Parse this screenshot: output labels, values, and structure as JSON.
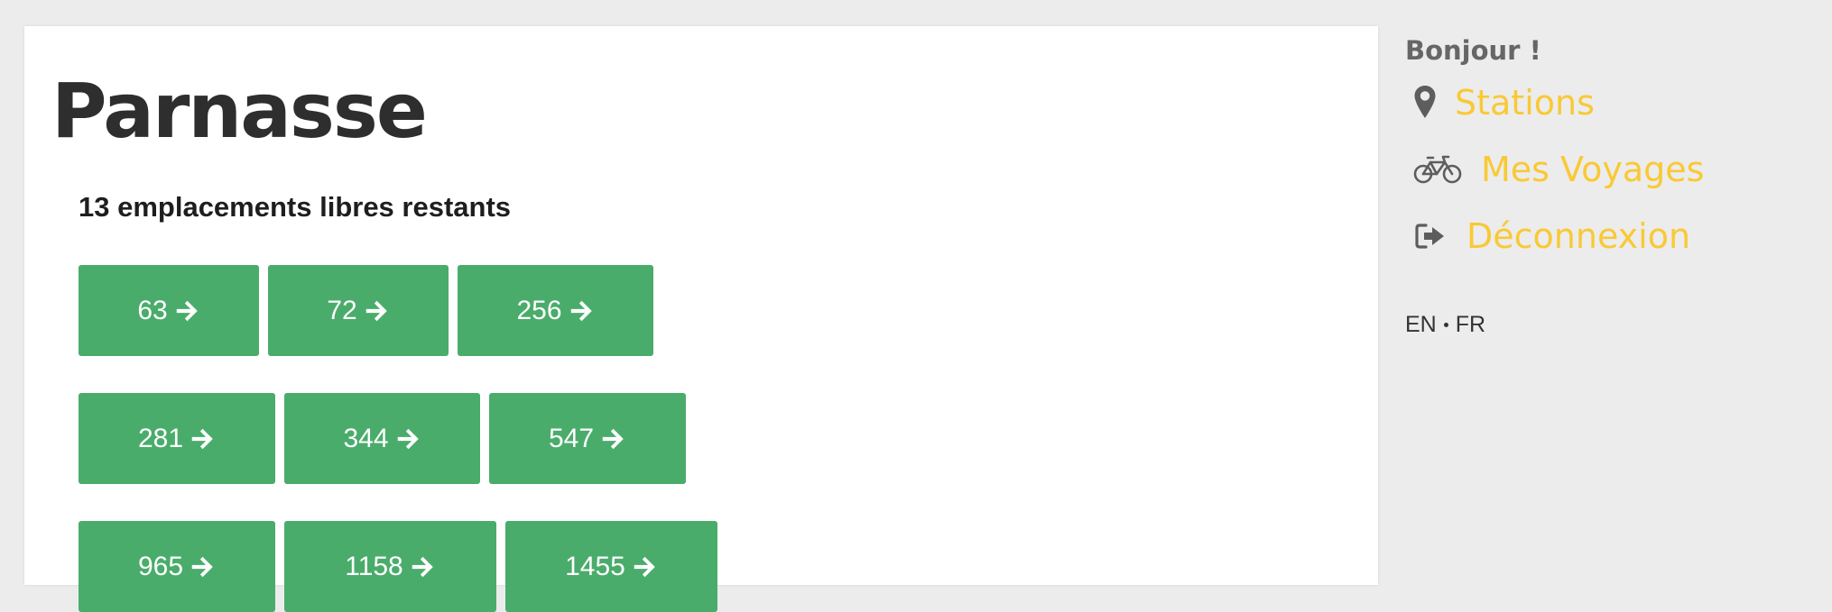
{
  "station": {
    "title": "Parnasse",
    "free_slots_text": "13 emplacements libres restants"
  },
  "slots": {
    "row1": [
      {
        "label": "63"
      },
      {
        "label": "72"
      },
      {
        "label": "256"
      }
    ],
    "row2": [
      {
        "label": "281"
      },
      {
        "label": "344"
      },
      {
        "label": "547"
      }
    ],
    "row3": [
      {
        "label": "965"
      },
      {
        "label": "1158"
      },
      {
        "label": "1455"
      }
    ]
  },
  "sidebar": {
    "greeting": "Bonjour !",
    "nav": [
      {
        "label": "Stations",
        "icon": "map-marker-icon"
      },
      {
        "label": "Mes Voyages",
        "icon": "bicycle-icon"
      },
      {
        "label": "Déconnexion",
        "icon": "sign-out-icon"
      }
    ],
    "languages": [
      "EN",
      "FR"
    ]
  },
  "colors": {
    "page_background": "#ececec",
    "card_background": "#ffffff",
    "slot_button": "#4aac6b",
    "nav_link": "#f9c935",
    "greeting_text": "#666666",
    "title_text": "#2e2e2e"
  }
}
